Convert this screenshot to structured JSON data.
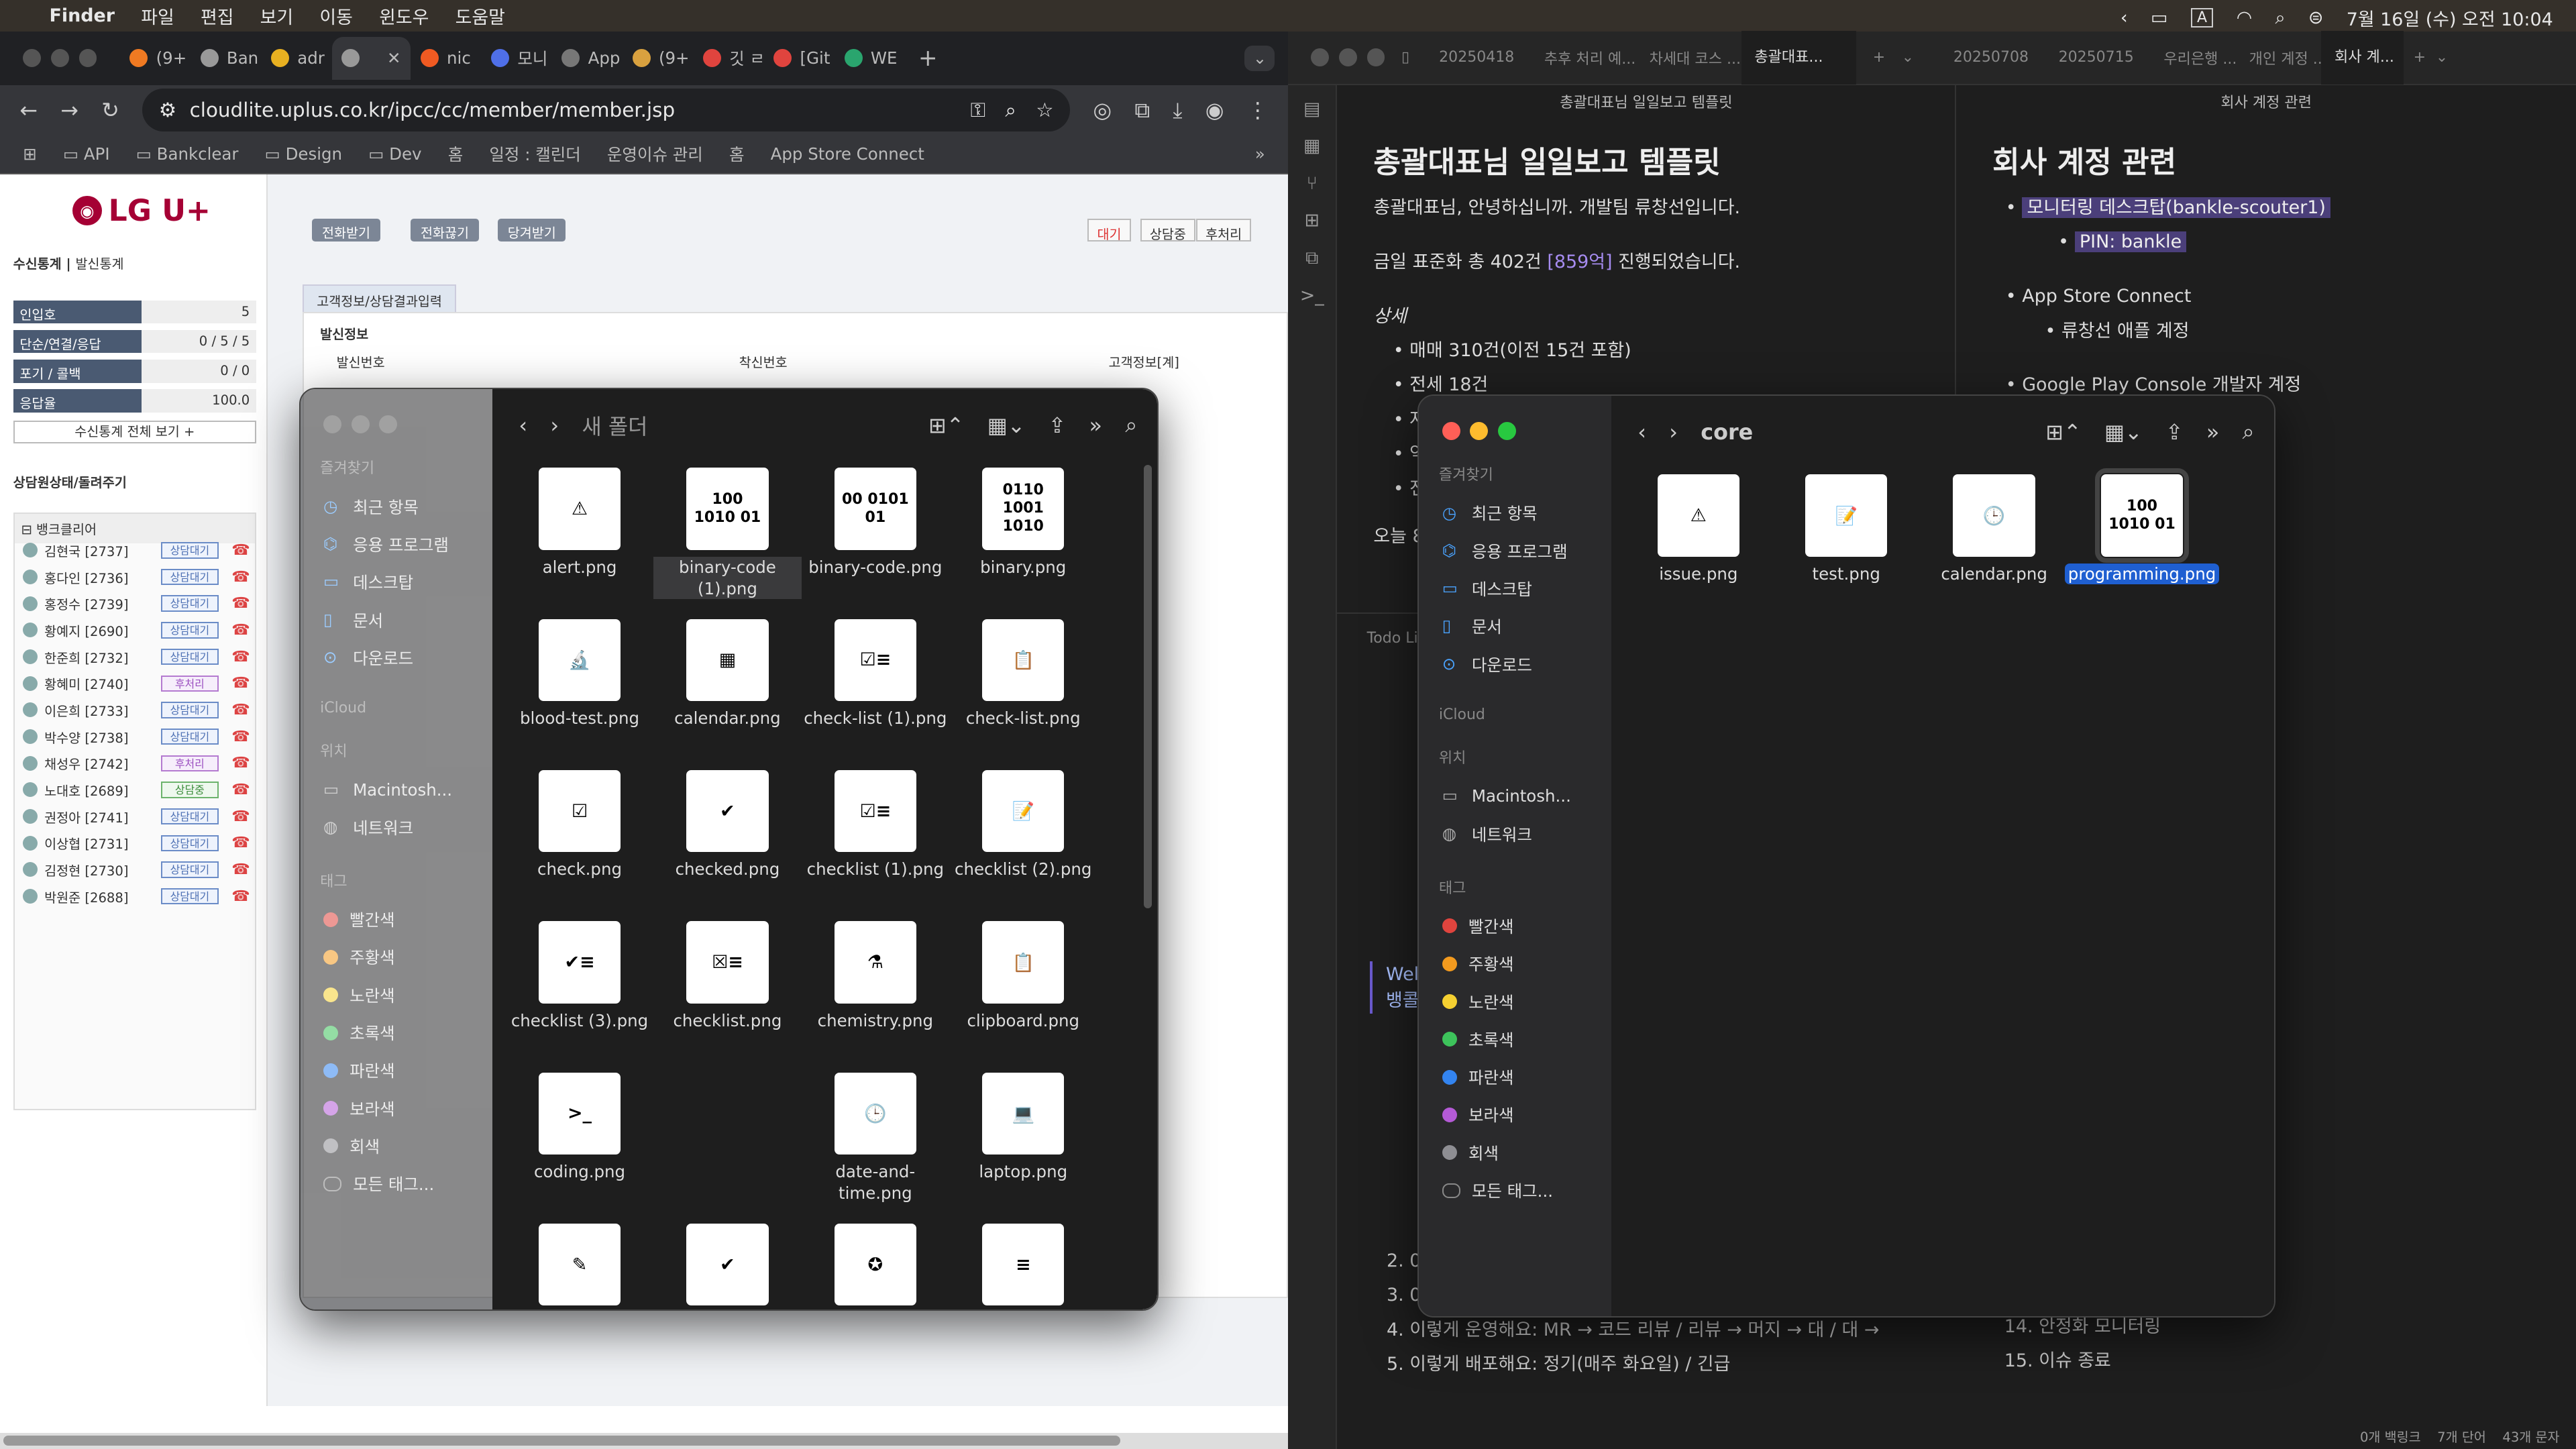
{
  "menubar": {
    "app": "Finder",
    "items": [
      "파일",
      "편집",
      "보기",
      "이동",
      "윈도우",
      "도움말"
    ],
    "clock": "7월 16일 (수) 오전 10:04"
  },
  "chrome": {
    "tabs": [
      "(9+",
      "Ban",
      "adr",
      "",
      "nic",
      "모니",
      "App",
      "(9+",
      "깃 ㄹ",
      "[Git",
      "WE"
    ],
    "url": "cloudlite.uplus.co.kr/ipcc/cc/member/member.jsp",
    "bookmarks": [
      "API",
      "Bankclear",
      "Design",
      "Dev",
      "홈",
      "일정 : 캘린더",
      "운영이슈 관리",
      "홈",
      "App Store Connect"
    ]
  },
  "lgu": {
    "logo": "LG U+",
    "stats_tab": "수신통계",
    "stats_tab2": "발신통계",
    "stats": [
      {
        "k": "인입호",
        "v": "5"
      },
      {
        "k": "단순/연결/응답",
        "v": "0 / 5 / 5"
      },
      {
        "k": "포기 / 콜백",
        "v": "0 / 0"
      },
      {
        "k": "응답율",
        "v": "100.0"
      }
    ],
    "stats_more": "수신통계 전체 보기 +",
    "agent_section": "상담원상태/돌려주기",
    "group": "뱅크클리어",
    "agents": [
      {
        "n": "김현국 [2737]",
        "s": "상담대기"
      },
      {
        "n": "홍다인 [2736]",
        "s": "상담대기"
      },
      {
        "n": "홍정수 [2739]",
        "s": "상담대기"
      },
      {
        "n": "황예지 [2690]",
        "s": "상담대기"
      },
      {
        "n": "한준희 [2732]",
        "s": "상담대기"
      },
      {
        "n": "황혜미 [2740]",
        "s": "후처리"
      },
      {
        "n": "이은희 [2733]",
        "s": "상담대기"
      },
      {
        "n": "박수양 [2738]",
        "s": "상담대기"
      },
      {
        "n": "채성우 [2742]",
        "s": "후처리"
      },
      {
        "n": "노대호 [2689]",
        "s": "상담중"
      },
      {
        "n": "권정아 [2741]",
        "s": "상담대기"
      },
      {
        "n": "이상협 [2731]",
        "s": "상담대기"
      },
      {
        "n": "김정현 [2730]",
        "s": "상담대기"
      },
      {
        "n": "박원준 [2688]",
        "s": "상담대기"
      }
    ],
    "call_buttons": [
      "전화받기",
      "전화끊기",
      "당겨받기"
    ],
    "state_buttons": [
      "대기",
      "상담중",
      "후처리"
    ],
    "form_tab": "고객정보/상담결과입력",
    "form_section": "발신정보",
    "form_labels": [
      "발신번호",
      "착신번호",
      "고객정보[계]"
    ]
  },
  "finder1": {
    "title": "새 폴더",
    "favorites_label": "즐겨찾기",
    "favorites": [
      "최근 항목",
      "응용 프로그램",
      "데스크탑",
      "문서",
      "다운로드"
    ],
    "icloud_label": "iCloud",
    "locations_label": "위치",
    "locations": [
      "Macintosh...",
      "네트워크"
    ],
    "tags_label": "태그",
    "tags": [
      {
        "n": "빨간색",
        "c": "#e0443e"
      },
      {
        "n": "주황색",
        "c": "#f39a1e"
      },
      {
        "n": "노란색",
        "c": "#f5d031"
      },
      {
        "n": "초록색",
        "c": "#3dc35b"
      },
      {
        "n": "파란색",
        "c": "#3384f0"
      },
      {
        "n": "보라색",
        "c": "#b45ad6"
      },
      {
        "n": "회색",
        "c": "#8e8e93"
      },
      {
        "n": "모든 태그...",
        "c": ""
      }
    ],
    "files": [
      {
        "n": "alert.png",
        "g": "⚠"
      },
      {
        "n": "binary-code (1).png",
        "g": "100 1010 01"
      },
      {
        "n": "binary-code.png",
        "g": "00 0101 01"
      },
      {
        "n": "binary.png",
        "g": "0110 1001 1010"
      },
      {
        "n": "blood-test.png",
        "g": "🔬"
      },
      {
        "n": "calendar.png",
        "g": "▦"
      },
      {
        "n": "check-list (1).png",
        "g": "☑≡"
      },
      {
        "n": "check-list.png",
        "g": "📋"
      },
      {
        "n": "check.png",
        "g": "☑"
      },
      {
        "n": "checked.png",
        "g": "✔"
      },
      {
        "n": "checklist (1).png",
        "g": "☑≡"
      },
      {
        "n": "checklist (2).png",
        "g": "📝"
      },
      {
        "n": "checklist (3).png",
        "g": "✔≡"
      },
      {
        "n": "checklist.png",
        "g": "☒≡"
      },
      {
        "n": "chemistry.png",
        "g": "⚗"
      },
      {
        "n": "clipboard.png",
        "g": "📋"
      },
      {
        "n": "coding.png",
        "g": ">_"
      },
      {
        "n": "",
        "g": ""
      },
      {
        "n": "date-and-time.png",
        "g": "🕒"
      },
      {
        "n": "laptop.png",
        "g": "💻"
      },
      {
        "n": "",
        "g": "✎"
      },
      {
        "n": "",
        "g": "✔"
      },
      {
        "n": "",
        "g": "✪"
      },
      {
        "n": "",
        "g": "≡"
      }
    ]
  },
  "finder2": {
    "title": "core",
    "favorites_label": "즐겨찾기",
    "favorites": [
      "최근 항목",
      "응용 프로그램",
      "데스크탑",
      "문서",
      "다운로드"
    ],
    "icloud_label": "iCloud",
    "locations_label": "위치",
    "locations": [
      "Macintosh...",
      "네트워크"
    ],
    "tags_label": "태그",
    "tags": [
      {
        "n": "빨간색",
        "c": "#e0443e"
      },
      {
        "n": "주황색",
        "c": "#f39a1e"
      },
      {
        "n": "노란색",
        "c": "#f5d031"
      },
      {
        "n": "초록색",
        "c": "#3dc35b"
      },
      {
        "n": "파란색",
        "c": "#3384f0"
      },
      {
        "n": "보라색",
        "c": "#b45ad6"
      },
      {
        "n": "회색",
        "c": "#8e8e93"
      },
      {
        "n": "모든 태그...",
        "c": ""
      }
    ],
    "files": [
      {
        "n": "issue.png",
        "g": "⚠"
      },
      {
        "n": "test.png",
        "g": "📝"
      },
      {
        "n": "calendar.png",
        "g": "🕒"
      },
      {
        "n": "programming.png",
        "g": "100 1010 01"
      }
    ]
  },
  "obsidian": {
    "left_tabs": [
      "20250418",
      "추후 처리 예...",
      "차세대 코스 ...",
      "총괄대표..."
    ],
    "right_tabs": [
      "20250708",
      "20250715",
      "우리은행 ...",
      "개인 계정 ...",
      "회사 계..."
    ],
    "left_header": "총괄대표님 일일보고 템플릿",
    "left_title": "총괄대표님 일일보고 템플릿",
    "left_lines": [
      "총괄대표님, 안녕하십니까. 개발팀 류창선입니다.",
      "금일 표준화 총 402건",
      "[859억]",
      "진행되었습니다.",
      "상세",
      "매매 310건(이전 15건 포함)",
      "전세 18건",
      "자",
      "역",
      "전",
      "오늘 8"
    ],
    "right_header": "회사 계정 관련",
    "right_title": "회사 계정 관련",
    "right_items": [
      "모니터링 데스크탑(bankle-scouter1)",
      "PIN: bankle",
      "App Store Connect",
      "류창선 애플 계정",
      "Google Play Console 개발자 계정"
    ],
    "bottom_left_tab": "Todo Li",
    "bottom_lines": [
      "2. 0",
      "3. 0",
      "4. 이렇게 운영해요: MR → 코드 리뷰 / 리뷰 → 머지 → 대 / 대 →",
      "5. 이렇게 배포해요: 정기(매주 화요일) / 긴급"
    ],
    "bottom_right_lines": [
      "14. 안정화 모니터링",
      "15. 이슈 종료"
    ],
    "welcome": "Wel",
    "welcome2": "뱅콜",
    "status": [
      "0개 백링크",
      "7개 단어",
      "43개 문자"
    ]
  }
}
